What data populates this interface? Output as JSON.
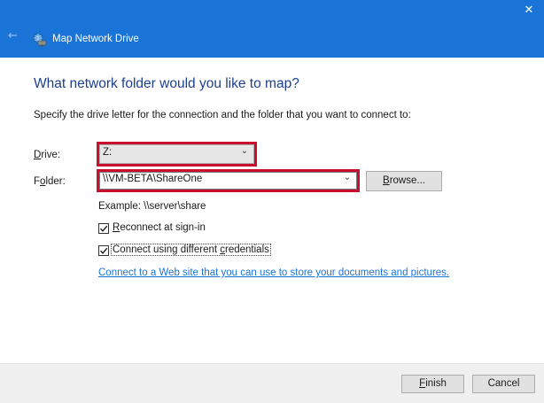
{
  "window": {
    "title": "Map Network Drive",
    "close_glyph": "✕",
    "back_glyph": "←"
  },
  "dialog": {
    "heading": "What network folder would you like to map?",
    "instructions": "Specify the drive letter for the connection and the folder that you want to connect to:",
    "drive_label_accel": "D",
    "drive_label_rest": "rive:",
    "drive_value": "Z:",
    "folder_label_prefix": "F",
    "folder_label_accel": "o",
    "folder_label_rest": "lder:",
    "folder_value": "\\\\VM-BETA\\ShareOne",
    "browse_accel": "B",
    "browse_rest": "rowse...",
    "example": "Example: \\\\server\\share",
    "reconnect_accel": "R",
    "reconnect_rest": "econnect at sign-in",
    "reconnect_checked": true,
    "credentials_prefix": "Connect using different ",
    "credentials_accel": "c",
    "credentials_rest": "redentials",
    "credentials_checked": true,
    "link_text": "Connect to a Web site that you can use to store your documents and pictures."
  },
  "footer": {
    "finish_accel": "F",
    "finish_rest": "inish",
    "cancel_label": "Cancel"
  },
  "colors": {
    "titlebar": "#1a73d6",
    "heading": "#1e3f8c",
    "highlight": "#c8102e",
    "link": "#1a73d6"
  },
  "icons": {
    "back": "back-arrow-icon",
    "drive": "network-drive-icon",
    "close": "close-icon",
    "dropdown": "chevron-down-icon",
    "check": "checkmark-icon"
  }
}
